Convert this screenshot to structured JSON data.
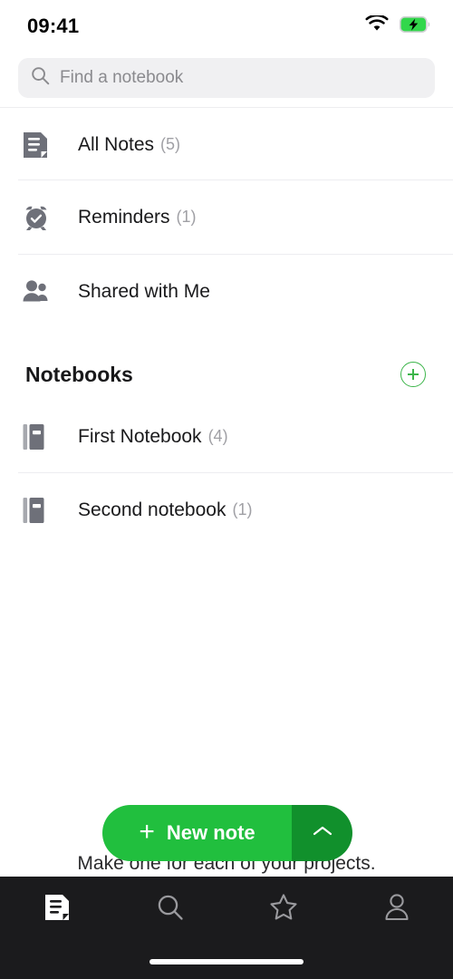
{
  "status_bar": {
    "time": "09:41",
    "wifi_icon": "wifi-icon",
    "battery_icon": "battery-charging-icon",
    "battery_color": "#32d74b"
  },
  "search": {
    "placeholder": "Find a notebook",
    "value": "",
    "icon": "search-icon"
  },
  "quick_access": [
    {
      "label": "All Notes",
      "count": "(5)",
      "icon": "note-icon"
    },
    {
      "label": "Reminders",
      "count": "(1)",
      "icon": "alarm-check-icon"
    },
    {
      "label": "Shared with Me",
      "count": "",
      "icon": "people-icon"
    }
  ],
  "notebooks_section": {
    "title": "Notebooks",
    "add_button_icon": "plus-circle-icon",
    "add_button_color": "#3cb54a",
    "items": [
      {
        "label": "First Notebook",
        "count": "(4)",
        "icon": "notebook-icon"
      },
      {
        "label": "Second notebook",
        "count": "(1)",
        "icon": "notebook-icon"
      }
    ]
  },
  "primary_action": {
    "plus": "+",
    "label": "New note",
    "chevron_icon": "chevron-up-icon",
    "color": "#21bf3e",
    "chevron_color": "#11902c"
  },
  "hint_text": "Make one for each of your projects.",
  "tab_bar": {
    "background": "#1b1b1d",
    "items": [
      {
        "name": "notes",
        "icon": "note-icon",
        "active": true
      },
      {
        "name": "search",
        "icon": "search-icon",
        "active": false
      },
      {
        "name": "shortcuts",
        "icon": "star-icon",
        "active": false
      },
      {
        "name": "account",
        "icon": "person-icon",
        "active": false
      }
    ]
  }
}
